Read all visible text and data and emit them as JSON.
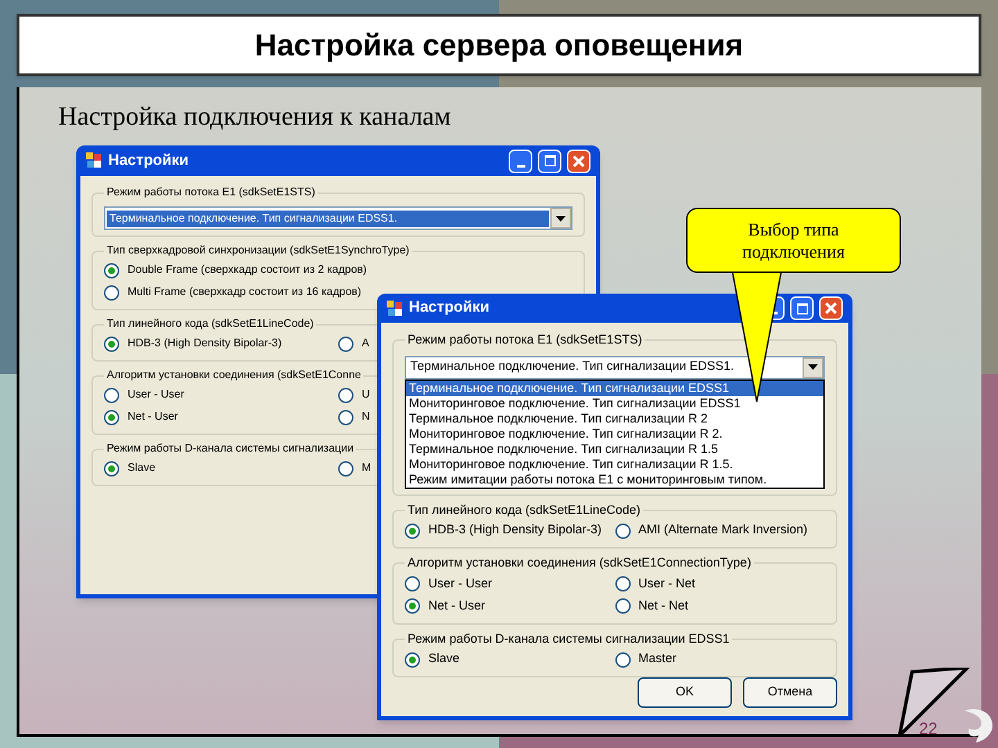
{
  "slide_title": "Настройка сервера оповещения",
  "subtitle": "Настройка подключения к каналам",
  "dialogs": [
    {
      "title": "Настройки",
      "groups": [
        {
          "kind": "combo",
          "title": "Режим работы потока E1 (sdkSetE1STS)",
          "value": "Терминальное подключение. Тип сигнализации EDSS1.",
          "highlighted": true
        },
        {
          "kind": "radio_list",
          "title": "Тип сверхкадровой синхронизации (sdkSetE1SynchroType)",
          "options": [
            {
              "label": "Double Frame (сверхкадр состоит из 2 кадров)",
              "selected": true
            },
            {
              "label": "Multi Frame (сверхкадр состоит из 16 кадров)",
              "selected": false
            }
          ]
        },
        {
          "kind": "radio_grid",
          "title": "Тип линейного кода (sdkSetE1LineCode)",
          "options": [
            {
              "label": "HDB-3 (High Density Bipolar-3)",
              "selected": true
            },
            {
              "label": "A",
              "selected": false
            }
          ]
        },
        {
          "kind": "radio_grid",
          "title": "Алгоритм установки соединения (sdkSetE1Conne",
          "options": [
            {
              "label": "User - User",
              "selected": false
            },
            {
              "label": "U",
              "selected": false
            },
            {
              "label": "Net - User",
              "selected": true
            },
            {
              "label": "N",
              "selected": false
            }
          ]
        },
        {
          "kind": "radio_grid",
          "title": "Режим работы D-канала системы сигнализации",
          "options": [
            {
              "label": "Slave",
              "selected": true
            },
            {
              "label": "M",
              "selected": false
            }
          ]
        }
      ]
    },
    {
      "title": "Настройки",
      "groups": [
        {
          "kind": "combo",
          "title": "Режим работы потока E1 (sdkSetE1STS)",
          "value": "Терминальное подключение. Тип сигнализации EDSS1.",
          "highlighted": false,
          "open_options": [
            {
              "label": "Терминальное подключение. Тип сигнализации EDSS1",
              "selected": true
            },
            {
              "label": "Мониторинговое подключение. Тип сигнализации EDSS1",
              "selected": false
            },
            {
              "label": "Терминальное подключение. Тип сигнализации R 2",
              "selected": false
            },
            {
              "label": "Мониторинговое подключение. Тип сигнализации R 2.",
              "selected": false
            },
            {
              "label": "Терминальное подключение. Тип сигнализации R 1.5",
              "selected": false
            },
            {
              "label": "Мониторинговое подключение. Тип сигнализации R 1.5.",
              "selected": false
            },
            {
              "label": "Режим имитации работы потока E1 с мониторинговым типом.",
              "selected": false
            }
          ]
        },
        {
          "kind": "radio_grid",
          "title": "Тип линейного кода (sdkSetE1LineCode)",
          "options": [
            {
              "label": "HDB-3 (High Density Bipolar-3)",
              "selected": true
            },
            {
              "label": "AMI (Alternate Mark Inversion)",
              "selected": false
            }
          ]
        },
        {
          "kind": "radio_grid",
          "title": "Алгоритм установки соединения (sdkSetE1ConnectionType)",
          "options": [
            {
              "label": "User - User",
              "selected": false
            },
            {
              "label": "User - Net",
              "selected": false
            },
            {
              "label": "Net - User",
              "selected": true
            },
            {
              "label": "Net - Net",
              "selected": false
            }
          ]
        },
        {
          "kind": "radio_grid",
          "title": "Режим работы D-канала системы сигнализации EDSS1",
          "options": [
            {
              "label": "Slave",
              "selected": true
            },
            {
              "label": "Master",
              "selected": false
            }
          ]
        }
      ],
      "buttons": [
        "OK",
        "Отмена"
      ]
    }
  ],
  "callout": "Выбор типа подключения",
  "page_number": "22"
}
